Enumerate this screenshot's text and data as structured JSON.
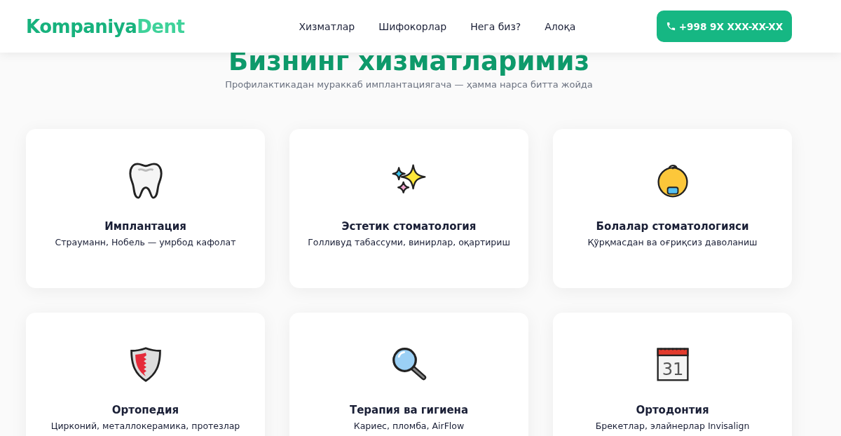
{
  "header": {
    "logo": {
      "part1": "Kompaniya",
      "part2": "Dent"
    },
    "nav": [
      {
        "label": "Хизматлар"
      },
      {
        "label": "Шифокорлар"
      },
      {
        "label": "Нега биз?"
      },
      {
        "label": "Алоқа"
      }
    ],
    "phone_button": "+998 9X XXX-XX-XX"
  },
  "section": {
    "title": "Бизнинг хизматларимиз",
    "subtitle": "Профилактикадан мураккаб имплантациягача — ҳамма нарса битта жойда"
  },
  "cards": [
    {
      "title": "Имплантация",
      "description": "Страуманн, Нобель — умрбод кафолат"
    },
    {
      "title": "Эстетик стоматология",
      "description": "Голливуд табассуми, винирлар, оқартириш"
    },
    {
      "title": "Болалар стоматологияси",
      "description": "Қўрқмасдан ва оғриқсиз даволаниш"
    },
    {
      "title": "Ортопедия",
      "description": "Цирконий, металлокерамика, протезлар"
    },
    {
      "title": "Терапия ва гигиена",
      "description": "Кариес, пломба, AirFlow"
    },
    {
      "icon_text": "31",
      "title": "Ортодонтия",
      "description": "Брекетлар, элайнерлар Invisalign"
    }
  ]
}
